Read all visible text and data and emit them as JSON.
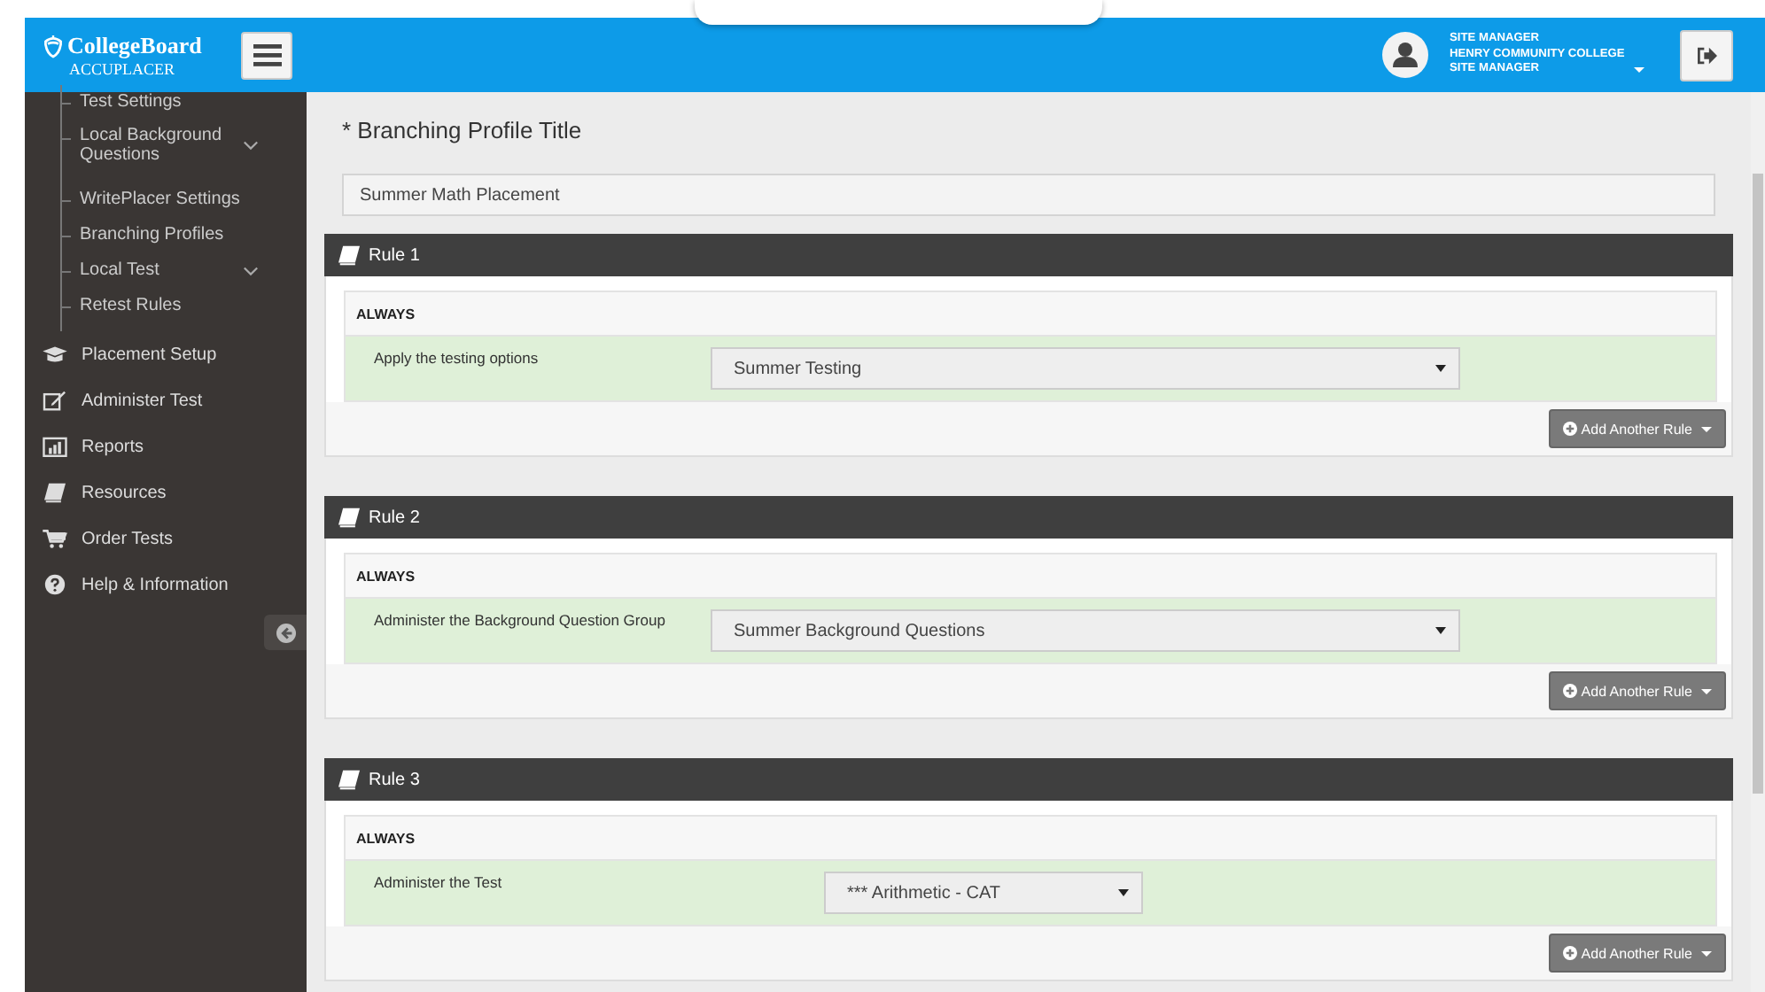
{
  "header": {
    "brand": "CollegeBoard",
    "product": "ACCUPLACER",
    "user_lines": [
      "SITE MANAGER",
      "HENRY COMMUNITY COLLEGE",
      "SITE MANAGER"
    ]
  },
  "sidebar": {
    "sub_items": [
      {
        "label": "Test Settings",
        "expandable": false
      },
      {
        "label": "Local Background Questions",
        "expandable": true
      },
      {
        "label": "WritePlacer Settings",
        "expandable": false
      },
      {
        "label": "Branching Profiles",
        "expandable": false
      },
      {
        "label": "Local Test",
        "expandable": true
      },
      {
        "label": "Retest Rules",
        "expandable": false
      }
    ],
    "items": [
      {
        "label": "Placement Setup",
        "kind": "cap"
      },
      {
        "label": "Administer Test",
        "kind": "edit"
      },
      {
        "label": "Reports",
        "kind": "chart"
      },
      {
        "label": "Resources",
        "kind": "book"
      },
      {
        "label": "Order Tests",
        "kind": "cart"
      },
      {
        "label": "Help & Information",
        "kind": "help"
      }
    ]
  },
  "profile": {
    "title_label": "* Branching Profile Title",
    "title_value": "Summer Math Placement"
  },
  "rules": [
    {
      "title": "Rule 1",
      "condition": "ALWAYS",
      "action": "Apply the testing options",
      "value": "Summer Testing",
      "kind": "option",
      "button": "Add Another Rule"
    },
    {
      "title": "Rule 2",
      "condition": "ALWAYS",
      "action": "Administer the Background Question Group",
      "value": "Summer Background Questions",
      "kind": "option",
      "button": "Add Another Rule"
    },
    {
      "title": "Rule 3",
      "condition": "ALWAYS",
      "action": "Administer the Test",
      "value": "*** Arithmetic - CAT",
      "kind": "test",
      "button": "Add Another Rule"
    }
  ]
}
